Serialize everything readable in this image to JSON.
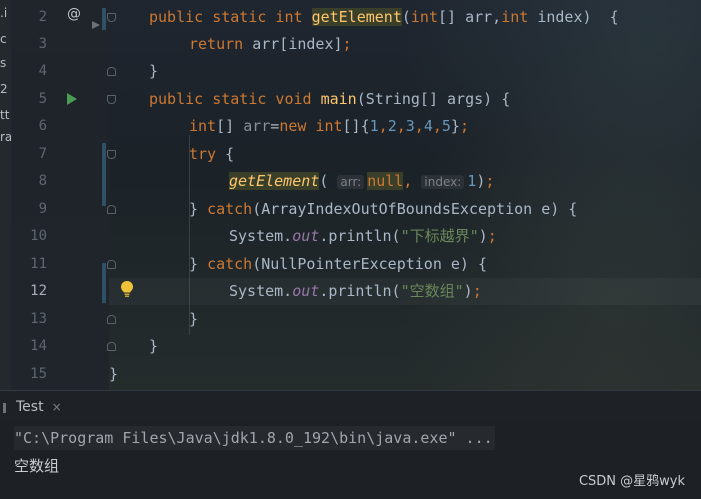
{
  "left_strip": [
    ".i",
    "c",
    "s",
    "2",
    "tt",
    "ra"
  ],
  "line_numbers": [
    "2",
    "3",
    "4",
    "5",
    "6",
    "7",
    "8",
    "9",
    "10",
    "11",
    "12",
    "13",
    "14",
    "15"
  ],
  "current_line": "12",
  "code": {
    "l2": {
      "kw": "public static int ",
      "fn": "getElement",
      "a": "(",
      "kw2": "int",
      "b": "[] arr,",
      "kw3": "int",
      "c": " index)  {"
    },
    "l3": {
      "kw": "return ",
      "a": "arr[index]",
      "sep": ";"
    },
    "l4": {
      "a": "}"
    },
    "l5": {
      "kw": "public static void ",
      "fn": "main",
      "a": "(String[] args) {"
    },
    "l6": {
      "kw": "int",
      "a": "[] ",
      "var": "arr",
      "b": "=",
      "kw2": "new ",
      "kw3": "int",
      "c": "[]{",
      "n1": "1",
      "c1": ",",
      "n2": "2",
      "c2": ",",
      "n3": "3",
      "c3": ",",
      "n4": "4",
      "c4": ",",
      "n5": "5",
      "d": "}",
      "sep": ";"
    },
    "l7": {
      "kw": "try ",
      "a": "{"
    },
    "l8": {
      "fn": "getElement",
      "a": "( ",
      "hint1": "arr:",
      "kw": "null",
      "sep": ",",
      "hint2": "index:",
      "num": "1",
      "b": ")",
      "sep2": ";"
    },
    "l9": {
      "a": "} ",
      "kw": "catch",
      "b": "(ArrayIndexOutOfBoundsException e) {"
    },
    "l10": {
      "a": "System.",
      "field": "out",
      "b": ".println(",
      "str": "\"下标越界\"",
      "c": ")",
      "sep": ";"
    },
    "l11": {
      "a": "} ",
      "kw": "catch",
      "b": "(NullPointerException e) {"
    },
    "l12": {
      "a": "System.",
      "field": "out",
      "b": ".println(",
      "str": "\"空数组\"",
      "c": ")",
      "sep": ";"
    },
    "l13": {
      "a": "}"
    },
    "l14": {
      "a": "}"
    },
    "l15": {
      "a": "}"
    }
  },
  "gutter_icons": {
    "override": "@"
  },
  "tool_window": {
    "tab_label": "Test",
    "close": "×"
  },
  "console": {
    "command": "\"C:\\Program Files\\Java\\jdk1.8.0_192\\bin\\java.exe\" ...",
    "output": "空数组"
  },
  "watermark": "CSDN @星鸦wyk",
  "colors": {
    "keyword": "#cc7832",
    "function": "#ffc66d",
    "number": "#6897bb",
    "string": "#6a8759",
    "field": "#9876aa",
    "text": "#a9b7c6"
  }
}
